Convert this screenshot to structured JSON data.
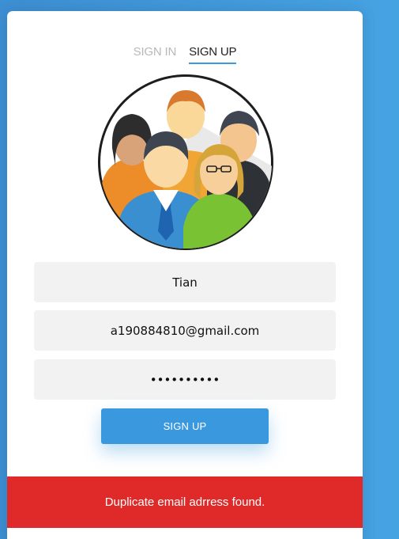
{
  "tabs": {
    "sign_in": "SIGN IN",
    "sign_up": "SIGN UP"
  },
  "form": {
    "name_value": "Tian",
    "email_value": "a190884810@gmail.com",
    "password_value": "abcdefghij"
  },
  "submit_label": "SIGN UP",
  "error_message": "Duplicate email adrress found.",
  "colors": {
    "accent": "#3a98de",
    "error": "#e02a2a",
    "background": "#46a3e2"
  }
}
